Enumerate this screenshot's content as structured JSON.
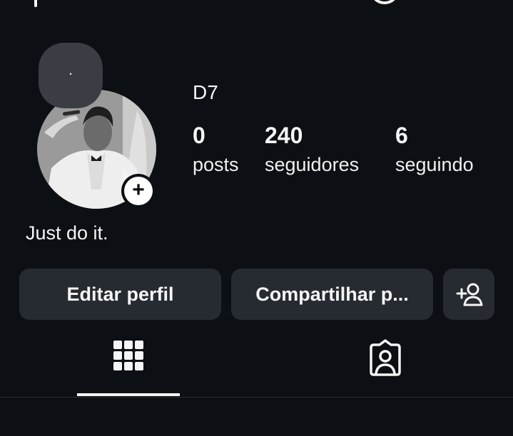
{
  "colors": {
    "background": "#0c0f14",
    "button": "#262a31",
    "text": "#f5f5f5",
    "note_bubble": "#3a3d44"
  },
  "header": {
    "icons": [
      "new-post-icon",
      "threads-icon",
      "menu-icon"
    ]
  },
  "profile": {
    "note_text": ".",
    "display_name": "D7",
    "bio": "Just do it.",
    "add_story_glyph": "+"
  },
  "stats": [
    {
      "value": "0",
      "label": "posts"
    },
    {
      "value": "240",
      "label": "seguidores"
    },
    {
      "value": "6",
      "label": "seguindo"
    }
  ],
  "buttons": {
    "edit_profile": "Editar perfil",
    "share_profile": "Compartilhar p...",
    "suggest_icon": "add-person-icon"
  },
  "tabs": [
    {
      "icon": "grid-icon",
      "selected": true
    },
    {
      "icon": "tagged-person-icon",
      "selected": false
    }
  ]
}
